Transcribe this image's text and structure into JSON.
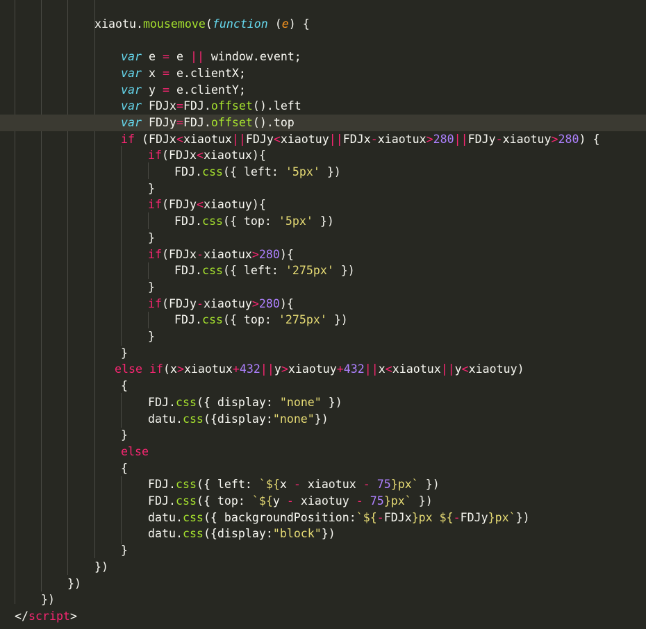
{
  "editor": {
    "language": "JavaScript (HTML script block)",
    "theme_colors": {
      "background": "#272822",
      "current_line": "#3b3a32",
      "indent_guide": "#4a4a44",
      "plain": "#f8f8f2",
      "keyword": "#f92672",
      "storage": "#66d9ef",
      "function": "#a6e22e",
      "number": "#ae81ff",
      "string": "#e6db74",
      "parameter": "#fd971f"
    },
    "lines": [
      [
        {
          "t": "xiaotu.",
          "c": "plain"
        },
        {
          "t": "mousemove",
          "c": "func"
        },
        {
          "t": "(",
          "c": "plain"
        },
        {
          "t": "function",
          "c": "storage"
        },
        {
          "t": " (",
          "c": "plain"
        },
        {
          "t": "e",
          "c": "italic-param"
        },
        {
          "t": ") {",
          "c": "plain"
        }
      ],
      [],
      [
        {
          "t": "var",
          "c": "storage"
        },
        {
          "t": " e ",
          "c": "plain"
        },
        {
          "t": "=",
          "c": "op"
        },
        {
          "t": " e ",
          "c": "plain"
        },
        {
          "t": "||",
          "c": "op"
        },
        {
          "t": " window.event;",
          "c": "plain"
        }
      ],
      [
        {
          "t": "var",
          "c": "storage"
        },
        {
          "t": " x ",
          "c": "plain"
        },
        {
          "t": "=",
          "c": "op"
        },
        {
          "t": " e.clientX;",
          "c": "plain"
        }
      ],
      [
        {
          "t": "var",
          "c": "storage"
        },
        {
          "t": " y ",
          "c": "plain"
        },
        {
          "t": "=",
          "c": "op"
        },
        {
          "t": " e.clientY;",
          "c": "plain"
        }
      ],
      [
        {
          "t": "var",
          "c": "storage"
        },
        {
          "t": " FDJx",
          "c": "plain"
        },
        {
          "t": "=",
          "c": "op"
        },
        {
          "t": "FDJ.",
          "c": "plain"
        },
        {
          "t": "offset",
          "c": "func"
        },
        {
          "t": "().left",
          "c": "plain"
        }
      ],
      [
        {
          "t": "var",
          "c": "storage"
        },
        {
          "t": " FDJy",
          "c": "plain"
        },
        {
          "t": "=",
          "c": "op"
        },
        {
          "t": "FDJ.",
          "c": "plain"
        },
        {
          "t": "offset",
          "c": "func"
        },
        {
          "t": "().top",
          "c": "plain"
        }
      ],
      [
        {
          "t": "if",
          "c": "keyword"
        },
        {
          "t": " (FDJx",
          "c": "plain"
        },
        {
          "t": "<",
          "c": "op"
        },
        {
          "t": "xiaotux",
          "c": "plain"
        },
        {
          "t": "||",
          "c": "op"
        },
        {
          "t": "FDJy",
          "c": "plain"
        },
        {
          "t": "<",
          "c": "op"
        },
        {
          "t": "xiaotuy",
          "c": "plain"
        },
        {
          "t": "||",
          "c": "op"
        },
        {
          "t": "FDJx",
          "c": "plain"
        },
        {
          "t": "-",
          "c": "op"
        },
        {
          "t": "xiaotux",
          "c": "plain"
        },
        {
          "t": ">",
          "c": "op"
        },
        {
          "t": "280",
          "c": "number"
        },
        {
          "t": "||",
          "c": "op"
        },
        {
          "t": "FDJy",
          "c": "plain"
        },
        {
          "t": "-",
          "c": "op"
        },
        {
          "t": "xiaotuy",
          "c": "plain"
        },
        {
          "t": ">",
          "c": "op"
        },
        {
          "t": "280",
          "c": "number"
        },
        {
          "t": ") {",
          "c": "plain"
        }
      ],
      [
        {
          "t": "if",
          "c": "keyword"
        },
        {
          "t": "(FDJx",
          "c": "plain"
        },
        {
          "t": "<",
          "c": "op"
        },
        {
          "t": "xiaotux){",
          "c": "plain"
        }
      ],
      [
        {
          "t": "FDJ.",
          "c": "plain"
        },
        {
          "t": "css",
          "c": "func"
        },
        {
          "t": "({ left: ",
          "c": "plain"
        },
        {
          "t": "'5px'",
          "c": "string"
        },
        {
          "t": " })",
          "c": "plain"
        }
      ],
      [
        {
          "t": "}",
          "c": "plain"
        }
      ],
      [
        {
          "t": "if",
          "c": "keyword"
        },
        {
          "t": "(FDJy",
          "c": "plain"
        },
        {
          "t": "<",
          "c": "op"
        },
        {
          "t": "xiaotuy){",
          "c": "plain"
        }
      ],
      [
        {
          "t": "FDJ.",
          "c": "plain"
        },
        {
          "t": "css",
          "c": "func"
        },
        {
          "t": "({ top: ",
          "c": "plain"
        },
        {
          "t": "'5px'",
          "c": "string"
        },
        {
          "t": " })",
          "c": "plain"
        }
      ],
      [
        {
          "t": "}",
          "c": "plain"
        }
      ],
      [
        {
          "t": "if",
          "c": "keyword"
        },
        {
          "t": "(FDJx",
          "c": "plain"
        },
        {
          "t": "-",
          "c": "op"
        },
        {
          "t": "xiaotux",
          "c": "plain"
        },
        {
          "t": ">",
          "c": "op"
        },
        {
          "t": "280",
          "c": "number"
        },
        {
          "t": "){",
          "c": "plain"
        }
      ],
      [
        {
          "t": "FDJ.",
          "c": "plain"
        },
        {
          "t": "css",
          "c": "func"
        },
        {
          "t": "({ left: ",
          "c": "plain"
        },
        {
          "t": "'275px'",
          "c": "string"
        },
        {
          "t": " })",
          "c": "plain"
        }
      ],
      [
        {
          "t": "}",
          "c": "plain"
        }
      ],
      [
        {
          "t": "if",
          "c": "keyword"
        },
        {
          "t": "(FDJy",
          "c": "plain"
        },
        {
          "t": "-",
          "c": "op"
        },
        {
          "t": "xiaotuy",
          "c": "plain"
        },
        {
          "t": ">",
          "c": "op"
        },
        {
          "t": "280",
          "c": "number"
        },
        {
          "t": "){",
          "c": "plain"
        }
      ],
      [
        {
          "t": "FDJ.",
          "c": "plain"
        },
        {
          "t": "css",
          "c": "func"
        },
        {
          "t": "({ top: ",
          "c": "plain"
        },
        {
          "t": "'275px'",
          "c": "string"
        },
        {
          "t": " })",
          "c": "plain"
        }
      ],
      [
        {
          "t": "}",
          "c": "plain"
        }
      ],
      [
        {
          "t": "}",
          "c": "plain"
        }
      ],
      [
        {
          "t": "else",
          "c": "keyword"
        },
        {
          "t": " ",
          "c": "plain"
        },
        {
          "t": "if",
          "c": "keyword"
        },
        {
          "t": "(x",
          "c": "plain"
        },
        {
          "t": ">",
          "c": "op"
        },
        {
          "t": "xiaotux",
          "c": "plain"
        },
        {
          "t": "+",
          "c": "op"
        },
        {
          "t": "432",
          "c": "number"
        },
        {
          "t": "||",
          "c": "op"
        },
        {
          "t": "y",
          "c": "plain"
        },
        {
          "t": ">",
          "c": "op"
        },
        {
          "t": "xiaotuy",
          "c": "plain"
        },
        {
          "t": "+",
          "c": "op"
        },
        {
          "t": "432",
          "c": "number"
        },
        {
          "t": "||",
          "c": "op"
        },
        {
          "t": "x",
          "c": "plain"
        },
        {
          "t": "<",
          "c": "op"
        },
        {
          "t": "xiaotux",
          "c": "plain"
        },
        {
          "t": "||",
          "c": "op"
        },
        {
          "t": "y",
          "c": "plain"
        },
        {
          "t": "<",
          "c": "op"
        },
        {
          "t": "xiaotuy)",
          "c": "plain"
        }
      ],
      [
        {
          "t": "{",
          "c": "plain"
        }
      ],
      [
        {
          "t": "FDJ.",
          "c": "plain"
        },
        {
          "t": "css",
          "c": "func"
        },
        {
          "t": "({ display: ",
          "c": "plain"
        },
        {
          "t": "\"none\"",
          "c": "string"
        },
        {
          "t": " })",
          "c": "plain"
        }
      ],
      [
        {
          "t": "datu.",
          "c": "plain"
        },
        {
          "t": "css",
          "c": "func"
        },
        {
          "t": "({display:",
          "c": "plain"
        },
        {
          "t": "\"none\"",
          "c": "string"
        },
        {
          "t": "})",
          "c": "plain"
        }
      ],
      [
        {
          "t": "}",
          "c": "plain"
        }
      ],
      [
        {
          "t": "else",
          "c": "keyword"
        }
      ],
      [
        {
          "t": "{",
          "c": "plain"
        }
      ],
      [
        {
          "t": "FDJ.",
          "c": "plain"
        },
        {
          "t": "css",
          "c": "func"
        },
        {
          "t": "({ left: ",
          "c": "plain"
        },
        {
          "t": "`${",
          "c": "string"
        },
        {
          "t": "x ",
          "c": "plain"
        },
        {
          "t": "-",
          "c": "op"
        },
        {
          "t": " xiaotux ",
          "c": "plain"
        },
        {
          "t": "-",
          "c": "op"
        },
        {
          "t": " ",
          "c": "plain"
        },
        {
          "t": "75",
          "c": "number"
        },
        {
          "t": "}px`",
          "c": "string"
        },
        {
          "t": " })",
          "c": "plain"
        }
      ],
      [
        {
          "t": "FDJ.",
          "c": "plain"
        },
        {
          "t": "css",
          "c": "func"
        },
        {
          "t": "({ top: ",
          "c": "plain"
        },
        {
          "t": "`${",
          "c": "string"
        },
        {
          "t": "y ",
          "c": "plain"
        },
        {
          "t": "-",
          "c": "op"
        },
        {
          "t": " xiaotuy ",
          "c": "plain"
        },
        {
          "t": "-",
          "c": "op"
        },
        {
          "t": " ",
          "c": "plain"
        },
        {
          "t": "75",
          "c": "number"
        },
        {
          "t": "}px`",
          "c": "string"
        },
        {
          "t": " })",
          "c": "plain"
        }
      ],
      [
        {
          "t": "datu.",
          "c": "plain"
        },
        {
          "t": "css",
          "c": "func"
        },
        {
          "t": "({ backgroundPosition:",
          "c": "plain"
        },
        {
          "t": "`${",
          "c": "string"
        },
        {
          "t": "-",
          "c": "op"
        },
        {
          "t": "FDJx",
          "c": "plain"
        },
        {
          "t": "}px ${",
          "c": "string"
        },
        {
          "t": "-",
          "c": "op"
        },
        {
          "t": "FDJy",
          "c": "plain"
        },
        {
          "t": "}px`",
          "c": "string"
        },
        {
          "t": "})",
          "c": "plain"
        }
      ],
      [
        {
          "t": "datu.",
          "c": "plain"
        },
        {
          "t": "css",
          "c": "func"
        },
        {
          "t": "({display:",
          "c": "plain"
        },
        {
          "t": "\"block\"",
          "c": "string"
        },
        {
          "t": "})",
          "c": "plain"
        }
      ],
      [
        {
          "t": "}",
          "c": "plain"
        }
      ],
      [
        {
          "t": "})",
          "c": "plain"
        }
      ],
      [
        {
          "t": "})",
          "c": "plain"
        }
      ],
      [
        {
          "t": "})",
          "c": "plain"
        }
      ],
      [
        {
          "t": "</",
          "c": "plain"
        },
        {
          "t": "script",
          "c": "tag"
        },
        {
          "t": ">",
          "c": "plain"
        }
      ]
    ]
  }
}
